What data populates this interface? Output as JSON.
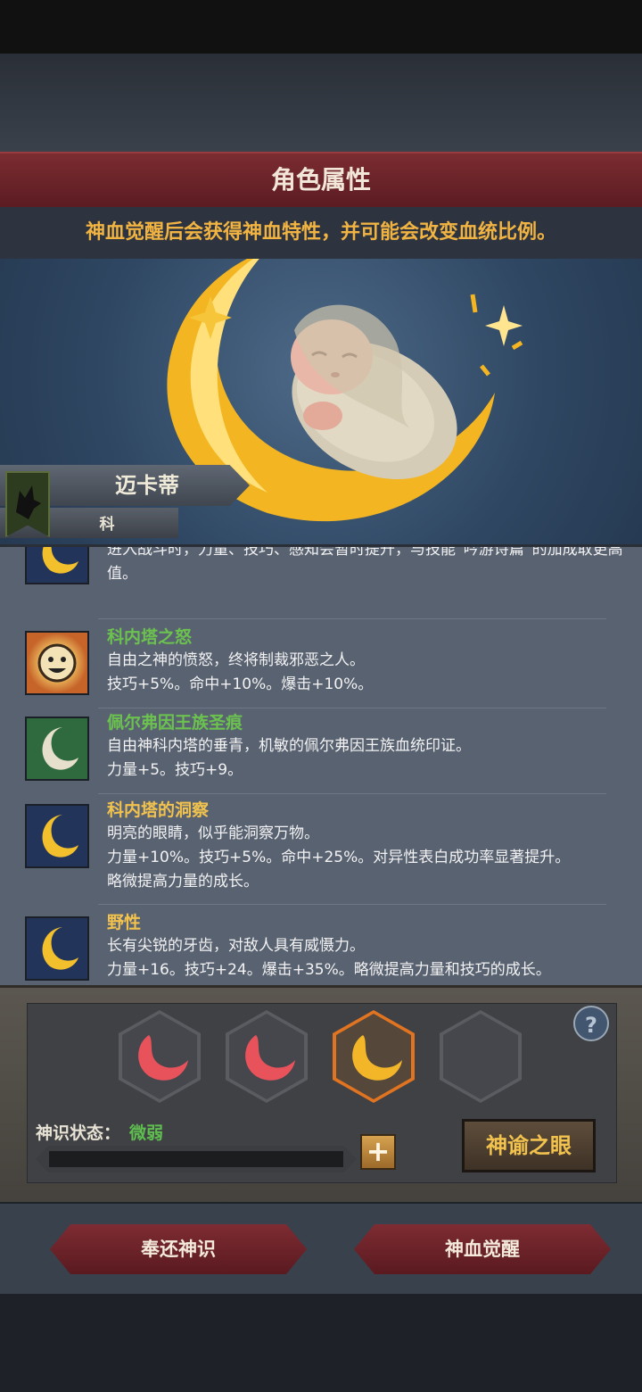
{
  "header": {
    "title": "角色属性",
    "subtitle": "神血觉醒后会获得神血特性，并可能会改变血统比例。"
  },
  "character": {
    "name": "迈卡蒂",
    "subname": "科"
  },
  "traits": [
    {
      "name": "",
      "desc": "进入战斗时，力量、技巧、感知会暂时提升，与技能“吟游诗篇”的加成取更高值。",
      "color": "#6bc24f",
      "icon": "moon-icon"
    },
    {
      "name": "科内塔之怒",
      "desc": "自由之神的愤怒，终将制裁邪恶之人。\n技巧+5%。命中+10%。爆击+10%。",
      "color": "#6bc24f",
      "icon": "sun-face-icon"
    },
    {
      "name": "佩尔弗因王族圣痕",
      "desc": "自由神科内塔的垂青，机敏的佩尔弗因王族血统印证。\n力量+5。技巧+9。",
      "color": "#6bc24f",
      "icon": "white-moon-icon"
    },
    {
      "name": "科内塔的洞察",
      "desc": "明亮的眼睛，似乎能洞察万物。\n力量+10%。技巧+5%。命中+25%。对异性表白成功率显著提升。\n略微提高力量的成长。",
      "color": "#f2c24e",
      "icon": "moon-icon"
    },
    {
      "name": "野性",
      "desc": "长有尖锐的牙齿，对敌人具有威慑力。\n力量+16。技巧+24。爆击+35%。略微提高力量和技巧的成长。",
      "color": "#f2c24e",
      "icon": "moon-icon"
    }
  ],
  "awakening": {
    "status_label": "神识状态：",
    "status_value": "微弱",
    "oracle_button": "神谕之眼",
    "plus_label": "+",
    "help_label": "?"
  },
  "footer": {
    "return_button": "奉还神识",
    "awaken_button": "神血觉醒"
  }
}
